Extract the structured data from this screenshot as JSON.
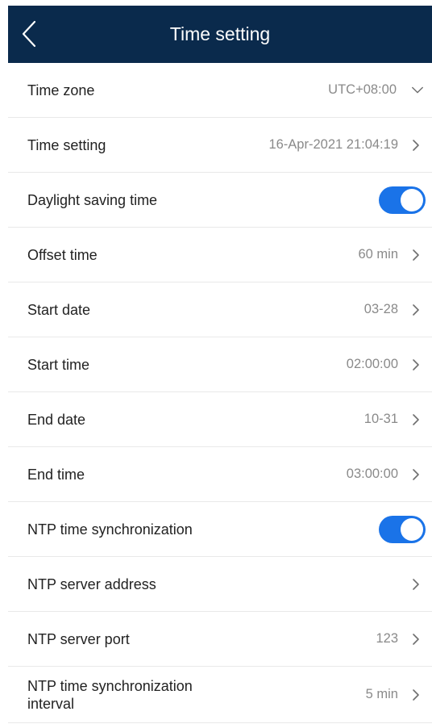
{
  "header": {
    "title": "Time setting",
    "back_icon": "chevron-left-icon"
  },
  "rows": {
    "timezone": {
      "label": "Time zone",
      "value": "UTC+08:00"
    },
    "time_setting": {
      "label": "Time setting",
      "value": "16-Apr-2021 21:04:19"
    },
    "dst": {
      "label": "Daylight saving time",
      "enabled": true
    },
    "offset": {
      "label": "Offset time",
      "value": "60 min"
    },
    "start_date": {
      "label": "Start date",
      "value": "03-28"
    },
    "start_time": {
      "label": "Start time",
      "value": "02:00:00"
    },
    "end_date": {
      "label": "End date",
      "value": "10-31"
    },
    "end_time": {
      "label": "End time",
      "value": "03:00:00"
    },
    "ntp_sync": {
      "label": "NTP time synchronization",
      "enabled": true
    },
    "ntp_server": {
      "label": "NTP server address",
      "value": ""
    },
    "ntp_port": {
      "label": "NTP server port",
      "value": "123"
    },
    "ntp_interval": {
      "label": "NTP time synchronization interval",
      "value": "5 min"
    }
  },
  "colors": {
    "header_bg": "#0a2a4c",
    "toggle_on": "#1a73e8",
    "value_text": "#8a8a8a"
  }
}
